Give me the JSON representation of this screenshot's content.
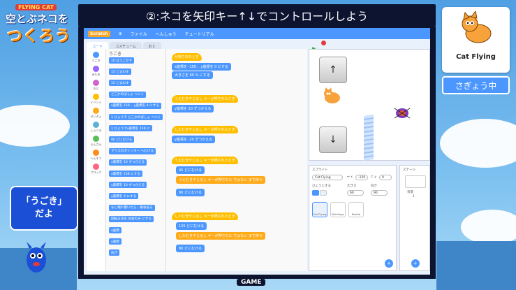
{
  "logo": {
    "small": "FLYING CAT",
    "line1": "空とぶネコを",
    "line2": "つくろう"
  },
  "title": "②:ネコを矢印キー↑↓でコントロールしよう",
  "menubar": {
    "logo": "Scratch",
    "items": [
      "ファイル",
      "へんしゅう",
      "チュートリアル"
    ]
  },
  "tabs": [
    "コード",
    "コスチューム",
    "おと"
  ],
  "categories": [
    {
      "label": "うごき",
      "color": "#4c97ff"
    },
    {
      "label": "みため",
      "color": "#9966ff"
    },
    {
      "label": "おと",
      "color": "#cf63cf"
    },
    {
      "label": "イベント",
      "color": "#ffbf00"
    },
    {
      "label": "せいぎょ",
      "color": "#ffab19"
    },
    {
      "label": "しらべる",
      "color": "#5cb1d6"
    },
    {
      "label": "えんざん",
      "color": "#59c059"
    },
    {
      "label": "へんすう",
      "color": "#ff8c1a"
    },
    {
      "label": "ブロック",
      "color": "#ff6680"
    }
  ],
  "palette": {
    "heading": "うごき",
    "blocks": [
      "10 ほうごかす",
      "15 どまわす",
      "15 どまわす",
      "どこかのばしょ へいく",
      "x座標を 158 、y座標を 4 にする",
      "1 びょうで どこかのばしょ へいく",
      "1 びょうでx座標を 158 に",
      "90 どにむける",
      "マウスのポインター へむける",
      "x座標を 10 ずつかえる",
      "x座標を 158 にする",
      "y座標を 10 ずつかえる",
      "y座標を 4 にする",
      "もし端に着いたら、跳ね返る",
      "回転方法を 左右のみ にする",
      "x座標",
      "y座標",
      "向き"
    ]
  },
  "code": [
    {
      "kind": "ev",
      "text": "が押されたとき"
    },
    {
      "kind": "mo",
      "text": "x座標を -150 、y座標を 0 にする"
    },
    {
      "kind": "mo",
      "text": "大きさを 60 % にする"
    },
    {
      "kind": "ev",
      "text": "うえむきやじるし キーが押されたとき"
    },
    {
      "kind": "mo",
      "text": "y座標を 20 ずつかえる"
    },
    {
      "kind": "ev",
      "text": "したむきやじるし キーが押されたとき"
    },
    {
      "kind": "mo",
      "text": "y座標を -20 ずつかえる"
    },
    {
      "kind": "ev",
      "text": "うえむきやじるし キーが押されたとき"
    },
    {
      "kind": "mo",
      "text": "45 どにむける"
    },
    {
      "kind": "ctl",
      "text": "うえむきやじるし キーが押された ではない まで待つ"
    },
    {
      "kind": "mo",
      "text": "90 どにむける"
    },
    {
      "kind": "ev",
      "text": "したむきやじるし キーが押されたとき"
    },
    {
      "kind": "mo",
      "text": "135 どにむける"
    },
    {
      "kind": "ctl",
      "text": "したむきやじるし キーが押された ではない まで待つ"
    },
    {
      "kind": "mo",
      "text": "90 どにむける"
    }
  ],
  "stage_keys": {
    "up": "↑",
    "down": "↓"
  },
  "sprite_pane": {
    "title": "スプライト",
    "name": "Cat Flying",
    "x": "-150",
    "y": "0",
    "show_label": "ひょうじする",
    "size_label": "大きさ",
    "size": "60",
    "dir_label": "向き",
    "dir": "90",
    "thumbs": [
      "Cat Flying",
      "Buildings",
      "Beetle"
    ]
  },
  "stage_pane": {
    "title": "ステージ",
    "backdrop_label": "背景",
    "backdrop_count": "1"
  },
  "right_card": {
    "label": "Cat Flying"
  },
  "status": "さぎょう中",
  "bubble": {
    "line1": "「うごき」",
    "line2": "だよ"
  },
  "footer": "GAME"
}
